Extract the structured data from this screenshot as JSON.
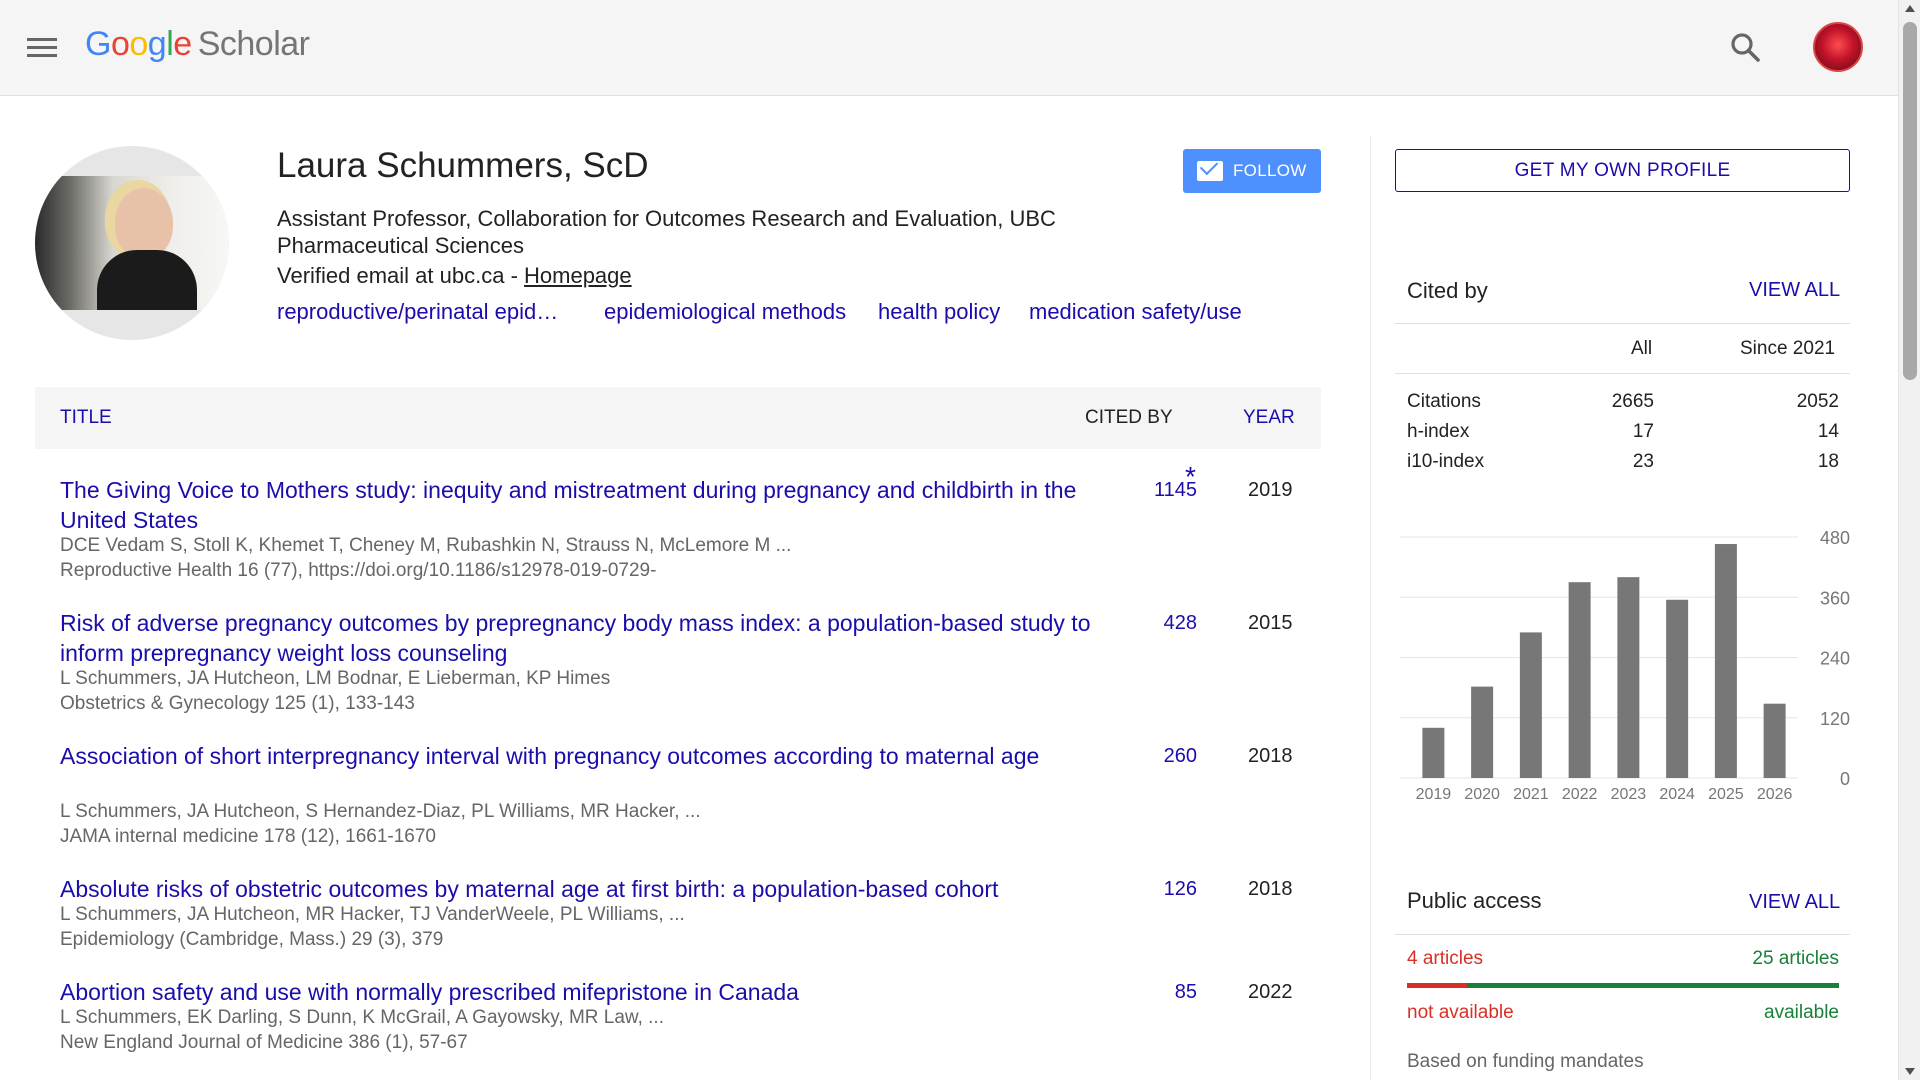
{
  "header": {
    "logo_google": [
      "G",
      "o",
      "o",
      "g",
      "l",
      "e"
    ],
    "logo_scholar": "Scholar",
    "menu_icon": "hamburger-menu-icon",
    "search_icon": "search-icon"
  },
  "profile": {
    "name": "Laura Schummers, ScD",
    "affiliation": "Assistant Professor, Collaboration for Outcomes Research and Evaluation, UBC Pharmaceutical Sciences",
    "email_text": "Verified email at ubc.ca - ",
    "homepage_label": "Homepage",
    "interests": [
      "reproductive/perinatal epid…",
      "epidemiological methods",
      "health policy",
      "medication safety/use"
    ],
    "follow_label": "FOLLOW"
  },
  "table": {
    "headers": {
      "title": "TITLE",
      "cited_by": "CITED BY",
      "year": "YEAR"
    },
    "rows": [
      {
        "title": "The Giving Voice to Mothers study: inequity and mistreatment during pregnancy and childbirth in the United States",
        "authors": "DCE Vedam S, Stoll K, Khemet T, Cheney M, Rubashkin N, Strauss N, McLemore M ...",
        "venue": "Reproductive Health 16 (77), https://doi.org/10.1186/s12978-019-0729-",
        "cited_by": "1145",
        "star": "*",
        "year": "2019"
      },
      {
        "title": "Risk of adverse pregnancy outcomes by prepregnancy body mass index: a population-based study to inform prepregnancy weight loss counseling",
        "authors": "L Schummers, JA Hutcheon, LM Bodnar, E Lieberman, KP Himes",
        "venue": "Obstetrics & Gynecology 125 (1), 133-143",
        "cited_by": "428",
        "year": "2015"
      },
      {
        "title": "Association of short interpregnancy interval with pregnancy outcomes according to maternal age",
        "authors": "L Schummers, JA Hutcheon, S Hernandez-Diaz, PL Williams, MR Hacker, ...",
        "venue": "JAMA internal medicine 178 (12), 1661-1670",
        "cited_by": "260",
        "year": "2018"
      },
      {
        "title": "Absolute risks of obstetric outcomes by maternal age at first birth: a population-based cohort",
        "authors": "L Schummers, JA Hutcheon, MR Hacker, TJ VanderWeele, PL Williams, ...",
        "venue": "Epidemiology (Cambridge, Mass.) 29 (3), 379",
        "cited_by": "126",
        "year": "2018"
      },
      {
        "title": "Abortion safety and use with normally prescribed mifepristone in Canada",
        "authors": "L Schummers, EK Darling, S Dunn, K McGrail, A Gayowsky, MR Law, ...",
        "venue": "New England Journal of Medicine 386 (1), 57-67",
        "cited_by": "85",
        "year": "2022"
      }
    ]
  },
  "sidebar": {
    "get_profile_label": "GET MY OWN PROFILE",
    "cited_by": {
      "title": "Cited by",
      "view_all": "VIEW ALL",
      "col_all": "All",
      "col_since": "Since 2021",
      "rows": [
        {
          "label": "Citations",
          "all": "2665",
          "since": "2052"
        },
        {
          "label": "h-index",
          "all": "17",
          "since": "14"
        },
        {
          "label": "i10-index",
          "all": "23",
          "since": "18"
        }
      ]
    },
    "public_access": {
      "title": "Public access",
      "view_all": "VIEW ALL",
      "not_available_count": "4 articles",
      "available_count": "25 articles",
      "not_available_label": "not available",
      "available_label": "available",
      "not_available_fraction": 0.138,
      "mandates": "Based on funding mandates",
      "colors": {
        "not_available": "#d93025",
        "available": "#188038"
      }
    }
  },
  "chart_data": {
    "type": "bar",
    "categories": [
      "2019",
      "2020",
      "2021",
      "2022",
      "2023",
      "2024",
      "2025",
      "2026"
    ],
    "values": [
      100,
      182,
      290,
      390,
      400,
      355,
      466,
      148
    ],
    "yticks": [
      "0",
      "120",
      "240",
      "360",
      "480"
    ],
    "ylim": [
      0,
      480
    ],
    "grid": true,
    "bar_color": "#777777"
  }
}
